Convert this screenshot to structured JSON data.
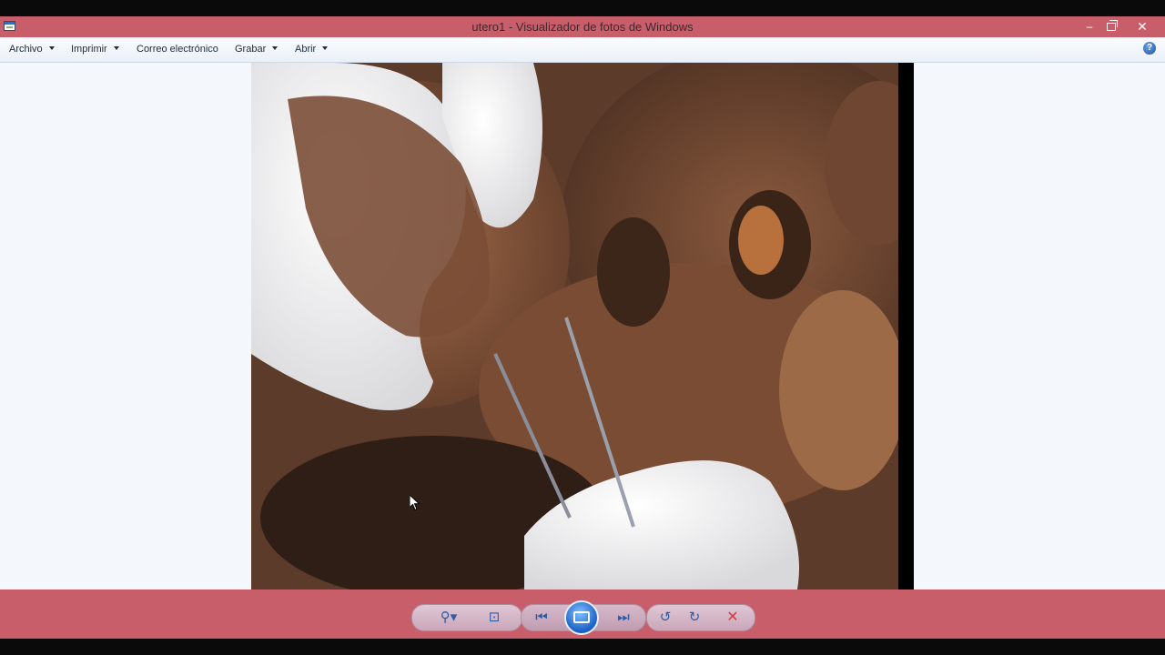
{
  "window": {
    "title": "utero1 - Visualizador de fotos de Windows",
    "minimize_glyph": "–",
    "close_glyph": "✕"
  },
  "menu": {
    "items": [
      {
        "label": "Archivo",
        "has_caret": true
      },
      {
        "label": "Imprimir",
        "has_caret": true
      },
      {
        "label": "Correo electrónico",
        "has_caret": false
      },
      {
        "label": "Grabar",
        "has_caret": true
      },
      {
        "label": "Abrir",
        "has_caret": true
      }
    ],
    "help_glyph": "?"
  },
  "toolbar": {
    "zoom_glyph": "⚲▾",
    "fit_glyph": "⊡",
    "prev_glyph": "⏮",
    "next_glyph": "⏭",
    "rotate_left_glyph": "↺",
    "rotate_right_glyph": "↻",
    "delete_glyph": "✕"
  },
  "icons": {
    "app": "photo-viewer-icon",
    "help": "help-icon",
    "zoom": "zoom-icon",
    "fit": "actual-size-icon",
    "prev": "previous-icon",
    "slideshow": "slideshow-icon",
    "next": "next-icon",
    "rotate_left": "rotate-left-icon",
    "rotate_right": "rotate-right-icon",
    "delete": "delete-icon",
    "cursor": "mouse-cursor-icon"
  },
  "colors": {
    "chrome_accent": "#c85e6a",
    "viewer_background": "#f4f7fb",
    "control_blue": "#2b5da8",
    "delete_red": "#d33a3a"
  }
}
